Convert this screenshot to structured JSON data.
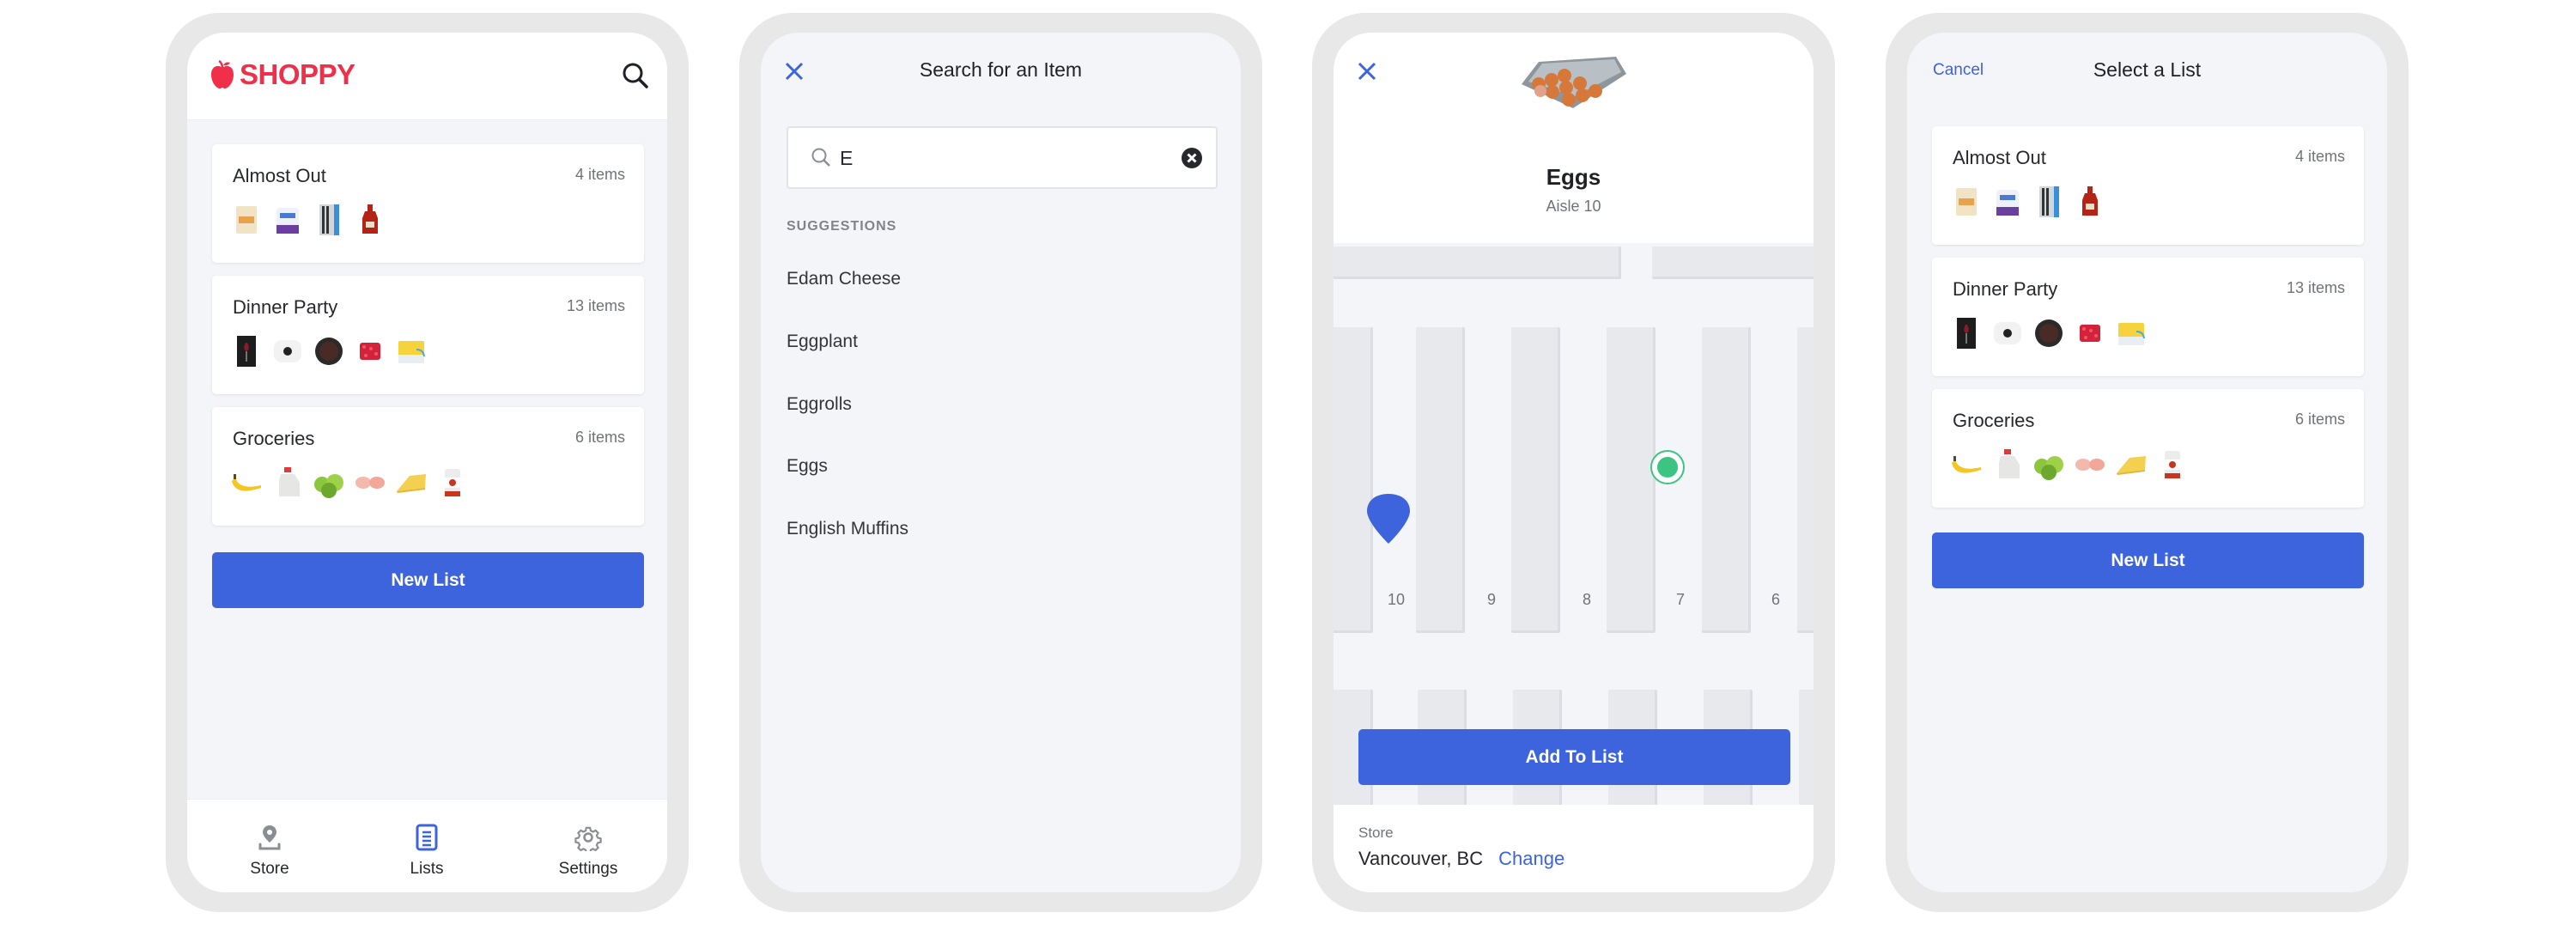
{
  "colors": {
    "accent": "#3d63dd",
    "brand": "#f0304a",
    "location_dot": "#3cc483",
    "background": "#f4f5f9"
  },
  "lists_screen": {
    "logo_text": "SHOPPY",
    "logo_icon": "apple-icon",
    "search_icon": "search-icon",
    "new_list_label": "New List",
    "nav": [
      {
        "label": "Store",
        "icon": "map-pin-icon",
        "active": false
      },
      {
        "label": "Lists",
        "icon": "list-document-icon",
        "active": true
      },
      {
        "label": "Settings",
        "icon": "gear-icon",
        "active": false
      }
    ]
  },
  "lists": [
    {
      "name": "Almost Out",
      "count": "4 items",
      "thumbs": [
        "flour-bag",
        "paper-towels",
        "pens",
        "ketchup"
      ]
    },
    {
      "name": "Dinner Party",
      "count": "13 items",
      "thumbs": [
        "wine-glasses",
        "plate",
        "cake",
        "raspberries",
        "cheese-box"
      ]
    },
    {
      "name": "Groceries",
      "count": "6 items",
      "thumbs": [
        "banana",
        "milk-jug",
        "apples",
        "shrimp",
        "cheese-wedge",
        "soup-can"
      ]
    }
  ],
  "search_screen": {
    "title": "Search for an Item",
    "query": "E",
    "suggestions_heading": "SUGGESTIONS",
    "suggestions": [
      "Edam Cheese",
      "Eggplant",
      "Eggrolls",
      "Eggs",
      "English Muffins"
    ]
  },
  "item_screen": {
    "item_name": "Eggs",
    "aisle": "Aisle 10",
    "aisle_numbers": [
      "10",
      "9",
      "8",
      "7",
      "6"
    ],
    "add_button": "Add To List",
    "store_label": "Store",
    "store_value": "Vancouver, BC",
    "change_link": "Change"
  },
  "select_screen": {
    "cancel": "Cancel",
    "title": "Select a List",
    "new_list_label": "New List"
  }
}
